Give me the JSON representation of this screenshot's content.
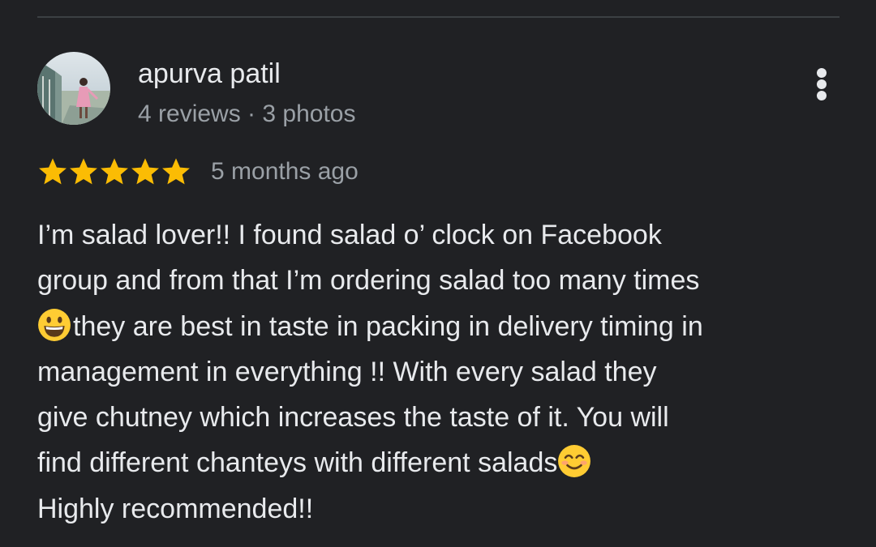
{
  "reviewer": {
    "name": "apurva patil",
    "meta": "4 reviews · 3 photos"
  },
  "rating": {
    "stars": 5,
    "max_stars": 5,
    "time_ago": "5 months ago",
    "star_color": "#fbbc04"
  },
  "review": {
    "lines": [
      "I’m salad lover!! I found salad o’ clock on Facebook",
      "group and from that I’m ordering salad too many times",
      "they are best in taste in packing in delivery timing in",
      "management in everything !! With every salad they",
      "give chutney which increases the taste of it. You will",
      "find different chanteys with different salads",
      "Highly recommended!!"
    ],
    "emojis": [
      "grinning-face-emoji",
      "smiling-face-with-smiling-eyes-emoji"
    ]
  },
  "theme": {
    "background": "#202124",
    "text_primary": "#e8eaed",
    "text_secondary": "#9aa0a6",
    "divider": "#3c4043"
  }
}
